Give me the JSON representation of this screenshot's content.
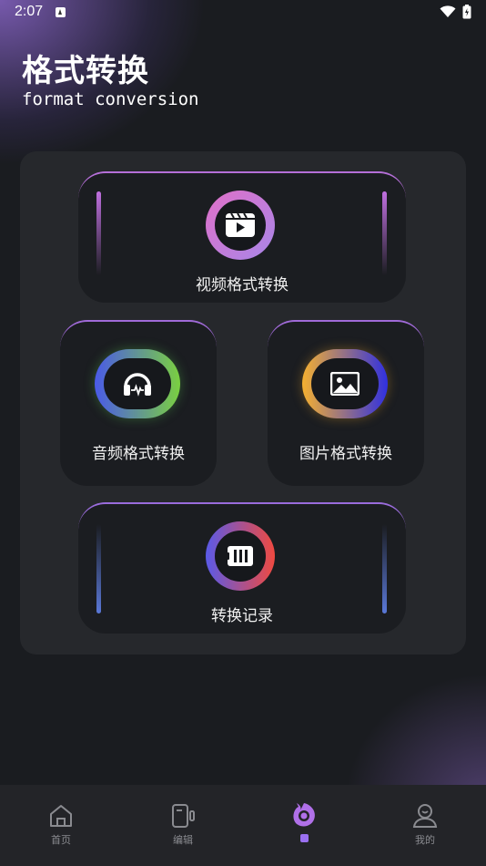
{
  "status_bar": {
    "time": "2:07"
  },
  "header": {
    "title": "格式转换",
    "subtitle": "format conversion"
  },
  "cards": {
    "video": {
      "label": "视频格式转换",
      "icon": "video-play-icon"
    },
    "audio": {
      "label": "音频格式转换",
      "icon": "headphones-icon"
    },
    "image": {
      "label": "图片格式转换",
      "icon": "image-icon"
    },
    "history": {
      "label": "转换记录",
      "icon": "history-icon"
    }
  },
  "bottom_nav": {
    "items": [
      {
        "label": "首页",
        "icon": "home-icon"
      },
      {
        "label": "编辑",
        "icon": "edit-device-icon"
      },
      {
        "label": "",
        "icon": "format-convert-icon",
        "active": true
      },
      {
        "label": "我的",
        "icon": "profile-icon"
      }
    ]
  },
  "colors": {
    "accent": "#9a70f0",
    "background": "#1a1c20",
    "panel": "#26282c",
    "card": "#1b1d21"
  }
}
